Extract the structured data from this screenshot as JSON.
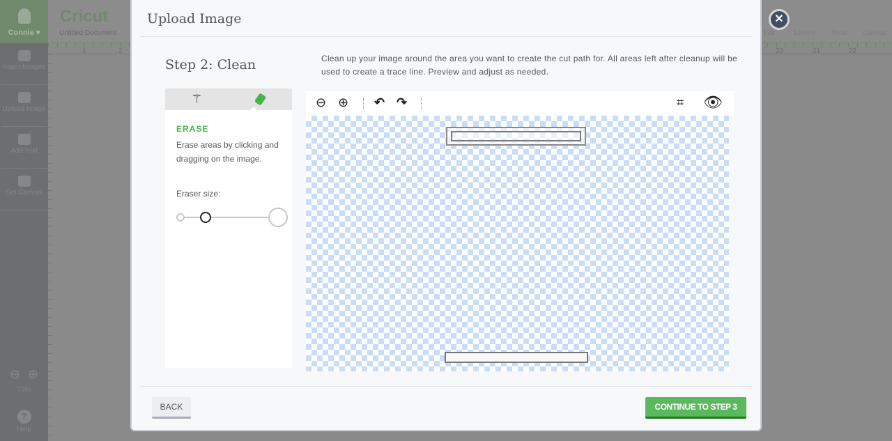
{
  "app": {
    "user": "Connie ▾",
    "logo": "Cricut",
    "document": "Untitled Document",
    "sidebar": [
      {
        "label": "Insert Images"
      },
      {
        "label": "Upload Image"
      },
      {
        "label": "Add Text"
      },
      {
        "label": "Set Canvas"
      }
    ],
    "zoom_level": "73%",
    "help": "Help",
    "top_actions": [
      "Edit",
      "Layers",
      "Sync",
      "Canvas"
    ],
    "ruler_top": [
      "1",
      "2",
      "20",
      "21",
      "22"
    ],
    "ruler_left": [
      "1",
      "2",
      "3",
      "4",
      "5",
      "6",
      "7",
      "8",
      "9",
      "10"
    ]
  },
  "modal": {
    "title": "Upload Image",
    "step": "Step 2: Clean",
    "instructions": "Clean up your image around the area you want to create the cut path for. All areas left after cleanup will be used to create a trace line. Preview and adjust as needed.",
    "tools": [
      {
        "icon": "magic-wand-icon",
        "active": false
      },
      {
        "icon": "eraser-icon",
        "active": true
      }
    ],
    "erase_heading": "ERASE",
    "erase_desc": "Erase areas by clicking and dragging on the image.",
    "eraser_size_label": "Eraser size:",
    "eraser_size_percent": 25,
    "toolbar": [
      "zoom-out-icon",
      "zoom-in-icon",
      "undo-icon",
      "redo-icon",
      "crop-icon",
      "preview-eye-icon"
    ],
    "back": "BACK",
    "continue": "CONTINUE TO STEP 3"
  },
  "colors": {
    "accent": "#5cb85c",
    "checker": "#c9ddf5",
    "close": "#454d63"
  }
}
